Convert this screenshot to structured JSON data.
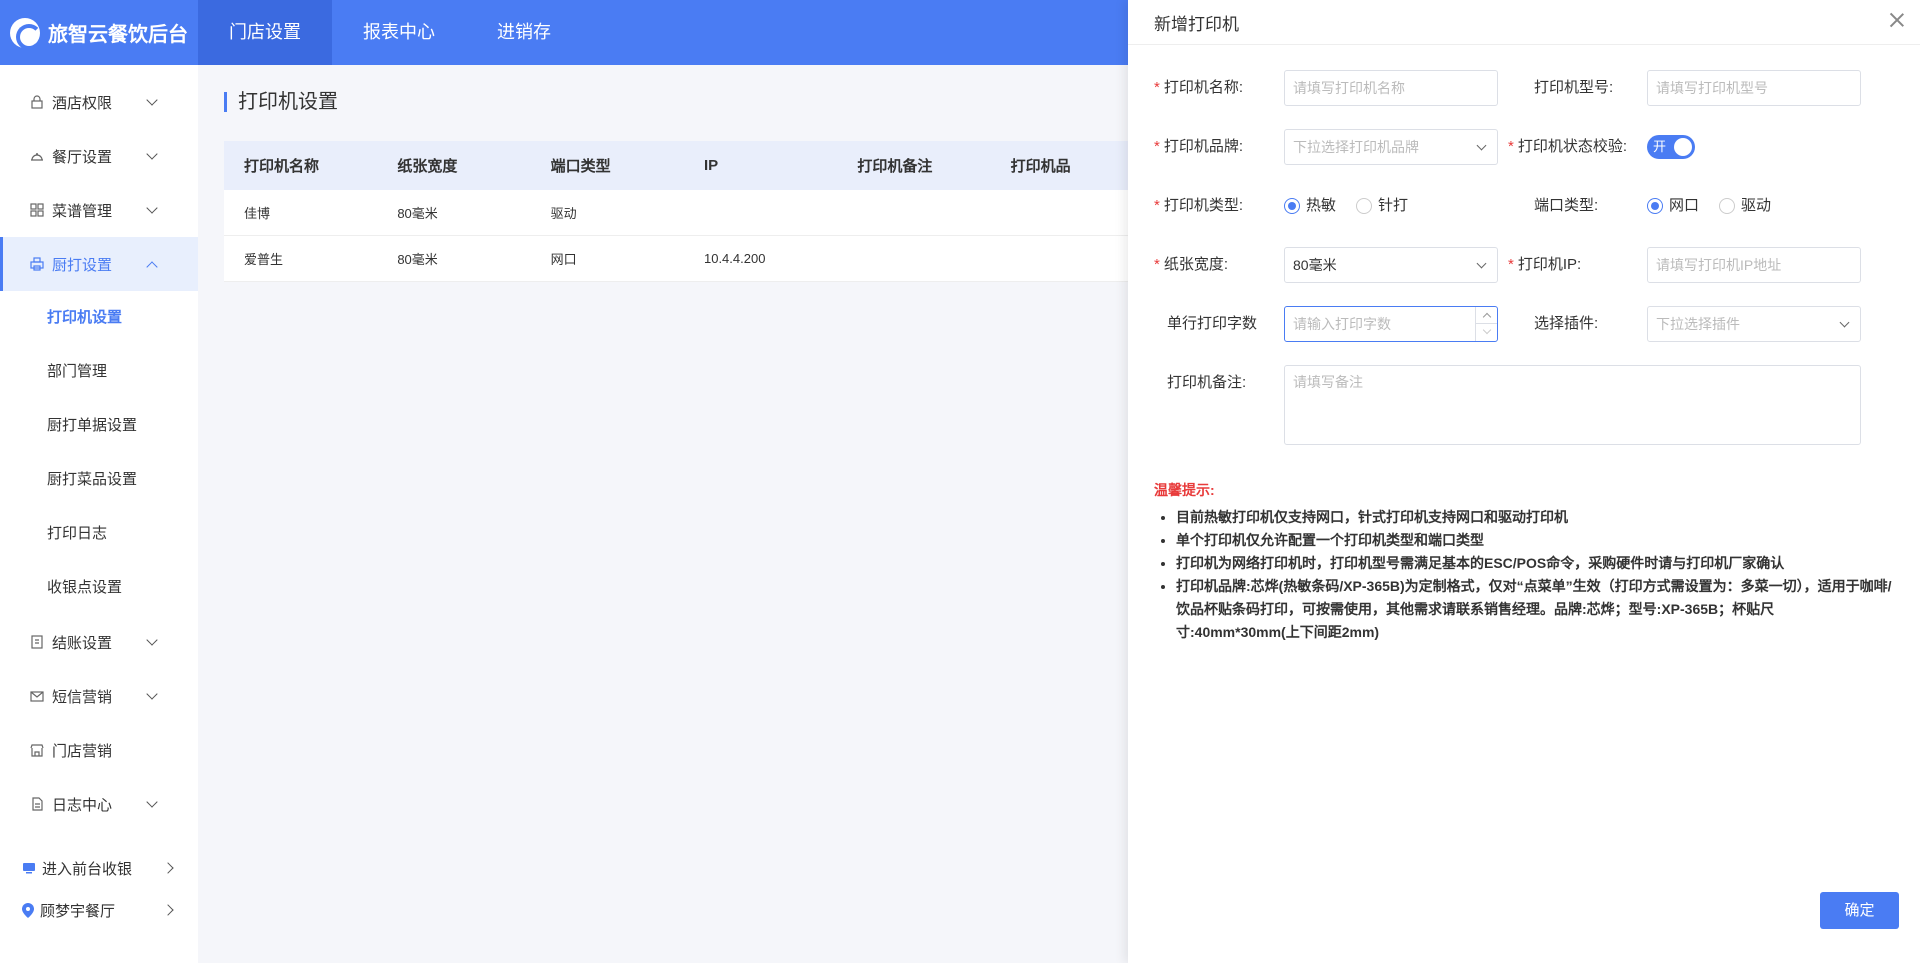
{
  "app": {
    "title": "旅智云餐饮后台"
  },
  "nav": [
    {
      "label": "门店设置"
    },
    {
      "label": "报表中心"
    },
    {
      "label": "进销存"
    }
  ],
  "sidebar": {
    "items": [
      {
        "label": "酒店权限"
      },
      {
        "label": "餐厅设置"
      },
      {
        "label": "菜谱管理"
      },
      {
        "label": "厨打设置"
      }
    ],
    "sub_items": [
      {
        "label": "打印机设置"
      },
      {
        "label": "部门管理"
      },
      {
        "label": "厨打单据设置"
      },
      {
        "label": "厨打菜品设置"
      },
      {
        "label": "打印日志"
      },
      {
        "label": "收银点设置"
      }
    ],
    "items2": [
      {
        "label": "结账设置"
      },
      {
        "label": "短信营销"
      },
      {
        "label": "门店营销"
      },
      {
        "label": "日志中心"
      }
    ],
    "bottom": [
      {
        "label": "进入前台收银"
      },
      {
        "label": "顾梦宇餐厅"
      }
    ]
  },
  "page": {
    "title": "打印机设置"
  },
  "table": {
    "headers": [
      "打印机名称",
      "纸张宽度",
      "端口类型",
      "IP",
      "打印机备注",
      "打印机品"
    ],
    "rows": [
      [
        "佳博",
        "80毫米",
        "驱动",
        "",
        "",
        ""
      ],
      [
        "爱普生",
        "80毫米",
        "网口",
        "10.4.4.200",
        "",
        ""
      ]
    ]
  },
  "panel": {
    "title": "新增打印机",
    "fields": {
      "printer_name": {
        "label": "打印机名称:",
        "placeholder": "请填写打印机名称"
      },
      "printer_model": {
        "label": "打印机型号:",
        "placeholder": "请填写打印机型号"
      },
      "printer_brand": {
        "label": "打印机品牌:",
        "placeholder": "下拉选择打印机品牌"
      },
      "status_check": {
        "label": "打印机状态校验:",
        "toggle_text": "开"
      },
      "printer_type": {
        "label": "打印机类型:",
        "options": [
          "热敏",
          "针打"
        ],
        "selected": "热敏"
      },
      "port_type": {
        "label": "端口类型:",
        "options": [
          "网口",
          "驱动"
        ],
        "selected": "网口"
      },
      "paper_width": {
        "label": "纸张宽度:",
        "value": "80毫米"
      },
      "printer_ip": {
        "label": "打印机IP:",
        "placeholder": "请填写打印机IP地址"
      },
      "chars_per_line": {
        "label": "单行打印字数",
        "placeholder": "请输入打印字数"
      },
      "plugin": {
        "label": "选择插件:",
        "placeholder": "下拉选择插件"
      },
      "remark": {
        "label": "打印机备注:",
        "placeholder": "请填写备注"
      }
    },
    "tips": {
      "title": "温馨提示:",
      "items": [
        "目前热敏打印机仅支持网口，针式打印机支持网口和驱动打印机",
        "单个打印机仅允许配置一个打印机类型和端口类型",
        "打印机为网络打印机时，打印机型号需满足基本的ESC/POS命令，采购硬件时请与打印机厂家确认",
        "打印机品牌:芯烨(热敏条码/XP-365B)为定制格式，仅对“点菜单”生效（打印方式需设置为：多菜一切），适用于咖啡/饮品杯贴条码打印，可按需使用，其他需求请联系销售经理。品牌:芯烨；型号:XP-365B；杯贴尺寸:40mm*30mm(上下间距2mm)"
      ]
    },
    "confirm_label": "确定"
  },
  "colors": {
    "brand": "#4a7cf3",
    "required": "#e83b3b"
  }
}
